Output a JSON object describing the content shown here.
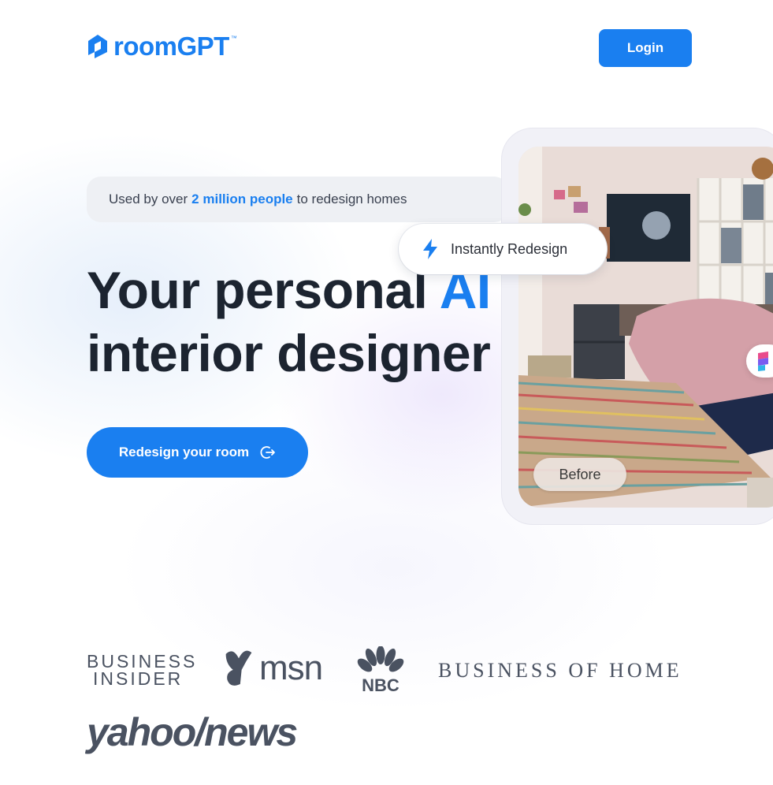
{
  "header": {
    "logo_text": "roomGPT",
    "logo_tm": "™",
    "login_label": "Login"
  },
  "hero": {
    "pill_prefix": "Used by over",
    "pill_highlight": "2 million people",
    "pill_suffix": "to redesign homes",
    "headline_line1_a": "Your personal ",
    "headline_line1_b": "AI",
    "headline_line2": "interior designer",
    "cta_label": "Redesign your room"
  },
  "showcase": {
    "instantly_label": "Instantly Redesign",
    "before_label": "Before"
  },
  "press": {
    "business_insider_line1": "BUSINESS",
    "business_insider_line2": "INSIDER",
    "msn": "msn",
    "nbc": "NBC",
    "business_of_home": "BUSINESS OF HOME",
    "yahoo_news": "yahoo/news"
  },
  "colors": {
    "accent": "#1a7ff0",
    "text_dark": "#1c2430",
    "press_gray": "#4a5261"
  }
}
